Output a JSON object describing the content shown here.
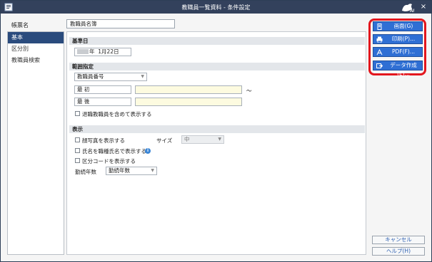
{
  "window": {
    "title": "教職員一覧資料 - 条件設定",
    "close_glyph": "×"
  },
  "form": {
    "name_label": "帳票名",
    "name_value": "教職員名簿"
  },
  "sidebar": {
    "items": [
      {
        "label": "基本",
        "active": true
      },
      {
        "label": "区分別",
        "active": false
      },
      {
        "label": "教職員検索",
        "active": false
      }
    ]
  },
  "base_date": {
    "header": "基準日",
    "year_suffix": "年",
    "month_day": "1月22日"
  },
  "range": {
    "header": "範囲指定",
    "field_select": "教職員番号",
    "first_label": "最 初",
    "last_label": "最 後",
    "tilde": "～",
    "include_retired": "退職教職員を含めて表示する"
  },
  "display": {
    "header": "表示",
    "show_photo": "顔写真を表示する",
    "size_label": "サイズ",
    "size_value": "中",
    "show_name_title": "氏名を職種氏名で表示する",
    "show_code": "区分コードを表示する",
    "years_label": "勤続年数",
    "years_value": "勤続年数"
  },
  "buttons": {
    "screen": "画面(G)",
    "print": "印刷(P)...",
    "pdf": "PDF(F)...",
    "data": "データ作成(E)...",
    "cancel": "キャンセル",
    "help": "ヘルプ(H)"
  },
  "colors": {
    "titlebar": "#33415c",
    "accent_button": "#2f6fd4",
    "highlight_frame": "#e3161d",
    "sidebar_active": "#2a4b7d"
  }
}
